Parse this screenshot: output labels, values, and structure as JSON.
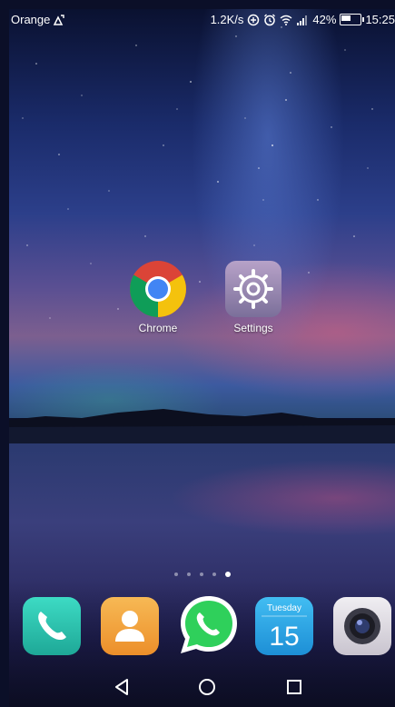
{
  "status_bar": {
    "carrier": "Orange",
    "network_speed": "1.2K/s",
    "battery_percent": "42%",
    "time": "15:25",
    "icons": [
      "signal-antenna-icon",
      "data-saver-icon",
      "alarm-icon",
      "wifi-icon",
      "cell-signal-icon",
      "battery-charging-icon"
    ]
  },
  "home_apps": [
    {
      "label": "Chrome",
      "icon": "chrome-icon"
    },
    {
      "label": "Settings",
      "icon": "settings-gear-icon"
    }
  ],
  "pager": {
    "count": 5,
    "active_index": 4
  },
  "dock": [
    {
      "icon": "phone-icon"
    },
    {
      "icon": "contacts-icon"
    },
    {
      "icon": "whatsapp-icon"
    },
    {
      "icon": "calendar-icon",
      "day_name": "Tuesday",
      "day_number": "15"
    },
    {
      "icon": "camera-icon"
    }
  ],
  "navigation": [
    "back-icon",
    "home-icon",
    "recents-icon"
  ],
  "colors": {
    "calendar_blue": "#2aa6e8",
    "phone_teal": "#2bc6b2",
    "contacts_orange": "#f2a33a",
    "whatsapp_green": "#2fd05b"
  }
}
